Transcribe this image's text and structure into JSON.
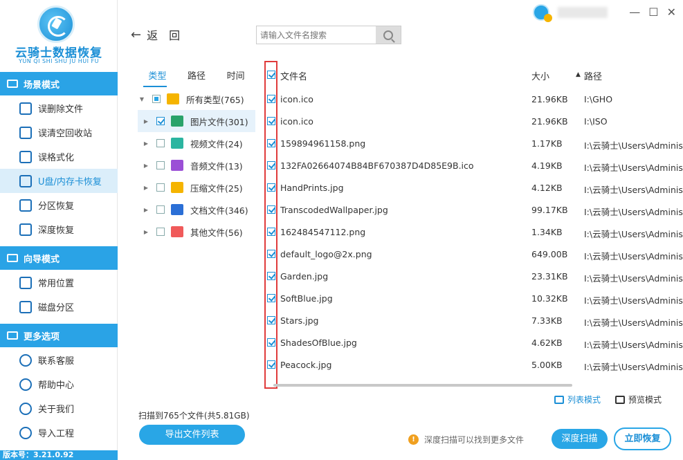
{
  "brand": {
    "title": "云骑士数据恢复",
    "subtitle": "YUN QI SHI SHU JU HUI FU",
    "version": "版本号：3.21.0.92"
  },
  "sidebar": {
    "sections": [
      {
        "title": "场景模式",
        "items": [
          {
            "label": "误删除文件",
            "icon": "deleted-file-icon"
          },
          {
            "label": "误清空回收站",
            "icon": "recycle-bin-icon"
          },
          {
            "label": "误格式化",
            "icon": "format-icon"
          },
          {
            "label": "U盘/内存卡恢复",
            "icon": "usb-card-icon",
            "active": true
          },
          {
            "label": "分区恢复",
            "icon": "partition-icon"
          },
          {
            "label": "深度恢复",
            "icon": "deep-recovery-icon"
          }
        ]
      },
      {
        "title": "向导模式",
        "items": [
          {
            "label": "常用位置",
            "icon": "windows-icon"
          },
          {
            "label": "磁盘分区",
            "icon": "disk-partition-icon"
          }
        ]
      },
      {
        "title": "更多选项",
        "items": [
          {
            "label": "联系客服",
            "icon": "phone-icon"
          },
          {
            "label": "帮助中心",
            "icon": "help-icon"
          },
          {
            "label": "关于我们",
            "icon": "info-icon"
          },
          {
            "label": "导入工程",
            "icon": "import-icon"
          }
        ]
      }
    ]
  },
  "topbar": {
    "back_label": "返　回",
    "search_placeholder": "请输入文件名搜索"
  },
  "tree": {
    "tabs": [
      "类型",
      "路径",
      "时间"
    ],
    "root": "所有类型(765)",
    "items": [
      {
        "label": "图片文件(301)",
        "color": "#2aa36a",
        "checked": true
      },
      {
        "label": "视频文件(24)",
        "color": "#2bb5a0",
        "checked": false
      },
      {
        "label": "音频文件(13)",
        "color": "#9b4fd6",
        "checked": false
      },
      {
        "label": "压缩文件(25)",
        "color": "#f5b400",
        "checked": false
      },
      {
        "label": "文档文件(346)",
        "color": "#2b6fd6",
        "checked": false
      },
      {
        "label": "其他文件(56)",
        "color": "#f05a5a",
        "checked": false
      }
    ]
  },
  "table": {
    "headers": {
      "name": "文件名",
      "size": "大小",
      "path": "路径"
    },
    "rows": [
      {
        "name": "icon.ico",
        "size": "21.96KB",
        "path": "I:\\GHO"
      },
      {
        "name": "icon.ico",
        "size": "21.96KB",
        "path": "I:\\ISO"
      },
      {
        "name": "159894961158.png",
        "size": "1.17KB",
        "path": "I:\\云骑士\\Users\\Administ"
      },
      {
        "name": "132FA02664074B84BF670387D4D85E9B.ico",
        "size": "4.19KB",
        "path": "I:\\云骑士\\Users\\Administ"
      },
      {
        "name": "HandPrints.jpg",
        "size": "4.12KB",
        "path": "I:\\云骑士\\Users\\Administ"
      },
      {
        "name": "TranscodedWallpaper.jpg",
        "size": "99.17KB",
        "path": "I:\\云骑士\\Users\\Administ"
      },
      {
        "name": "162484547112.png",
        "size": "1.34KB",
        "path": "I:\\云骑士\\Users\\Administ"
      },
      {
        "name": "default_logo@2x.png",
        "size": "649.00B",
        "path": "I:\\云骑士\\Users\\Administ"
      },
      {
        "name": "Garden.jpg",
        "size": "23.31KB",
        "path": "I:\\云骑士\\Users\\Administ"
      },
      {
        "name": "SoftBlue.jpg",
        "size": "10.32KB",
        "path": "I:\\云骑士\\Users\\Administ"
      },
      {
        "name": "Stars.jpg",
        "size": "7.33KB",
        "path": "I:\\云骑士\\Users\\Administ"
      },
      {
        "name": "ShadesOfBlue.jpg",
        "size": "4.62KB",
        "path": "I:\\云骑士\\Users\\Administ"
      },
      {
        "name": "Peacock.jpg",
        "size": "5.00KB",
        "path": "I:\\云骑士\\Users\\Administ"
      }
    ]
  },
  "view": {
    "list_label": "列表模式",
    "preview_label": "预览模式"
  },
  "footer": {
    "scan_info": "扫描到765个文件(共5.81GB)",
    "export_label": "导出文件列表",
    "hint": "深度扫描可以找到更多文件",
    "deep_scan_label": "深度扫描",
    "recover_label": "立即恢复"
  },
  "colors": {
    "accent": "#29a6e6",
    "highlight": "#e03a3a"
  }
}
